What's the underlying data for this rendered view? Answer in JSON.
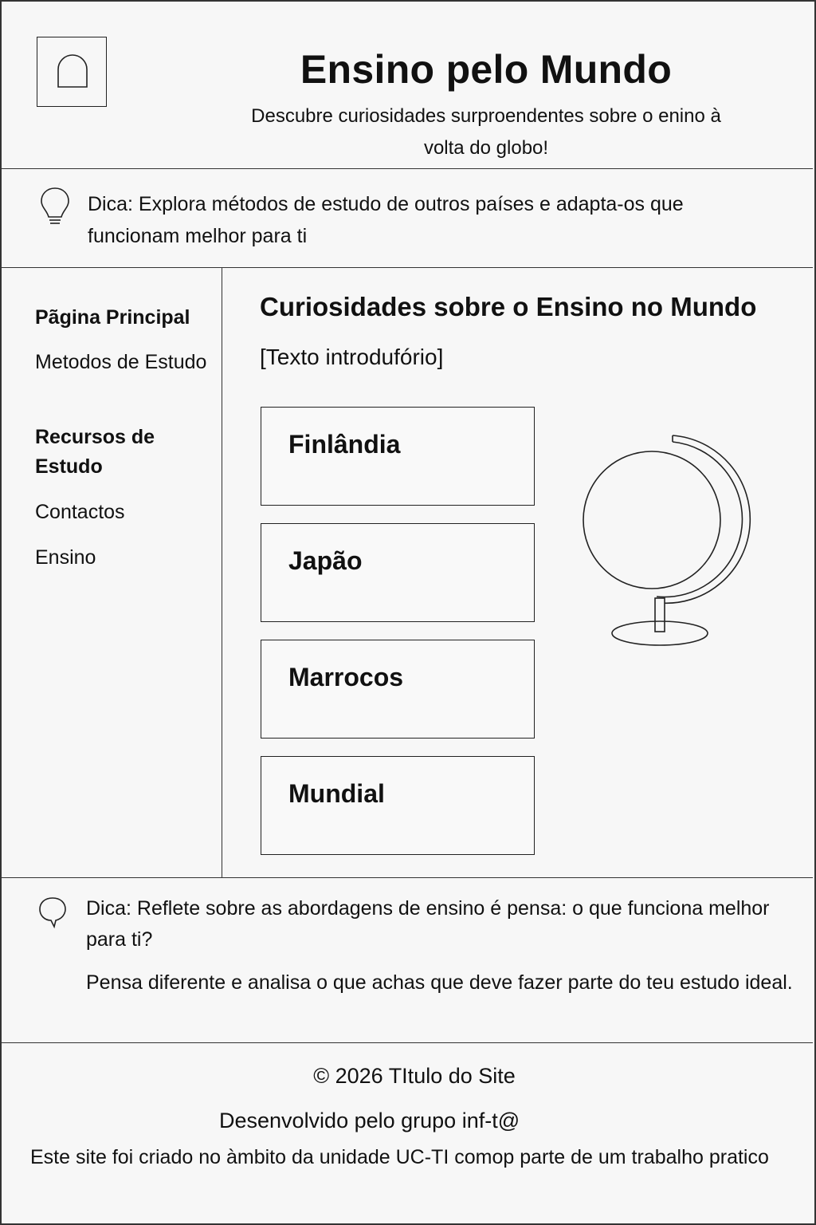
{
  "header": {
    "site_title": "Ensino pelo Mundo",
    "subtitle": "Descubre curiosidades surproendentes sobre o enino à volta do globo!",
    "logo_icon": "arch-icon"
  },
  "tip_top": {
    "icon": "lightbulb-icon",
    "text": "Dica: Explora métodos de estudo de outros países e adapta-os que funcionam melhor para ti"
  },
  "sidebar": {
    "items": [
      {
        "label": "Pãgina Principal",
        "bold": true
      },
      {
        "label": "Metodos de Estudo",
        "bold": false
      },
      {
        "label": "Recursos de Estudo",
        "bold": true
      },
      {
        "label": "Contactos",
        "bold": false
      },
      {
        "label": "Ensino",
        "bold": false
      }
    ]
  },
  "main": {
    "heading": "Curiosidades sobre o Ensino no Mundo",
    "intro": "[Texto introdufório]",
    "cards": [
      {
        "label": "Finlândia"
      },
      {
        "label": "Japão"
      },
      {
        "label": "Marrocos"
      },
      {
        "label": "Mundial"
      }
    ],
    "illustration": "globe-icon"
  },
  "tip_bottom": {
    "icon": "speech-bubble-icon",
    "text1": "Dica: Reflete sobre as abordagens de ensino é pensa:  o que funciona melhor para ti?",
    "text2": "Pensa diferente e analisa o que achas que deve fazer parte do teu estudo ideal."
  },
  "footer": {
    "copyright": "© 2026 TItulo do Site",
    "developed_by": "Desenvolvido pelo grupo inf-t@",
    "note": "Este site foi criado no àmbito da unidade UC-TI comop parte de um trabalho pratico"
  }
}
